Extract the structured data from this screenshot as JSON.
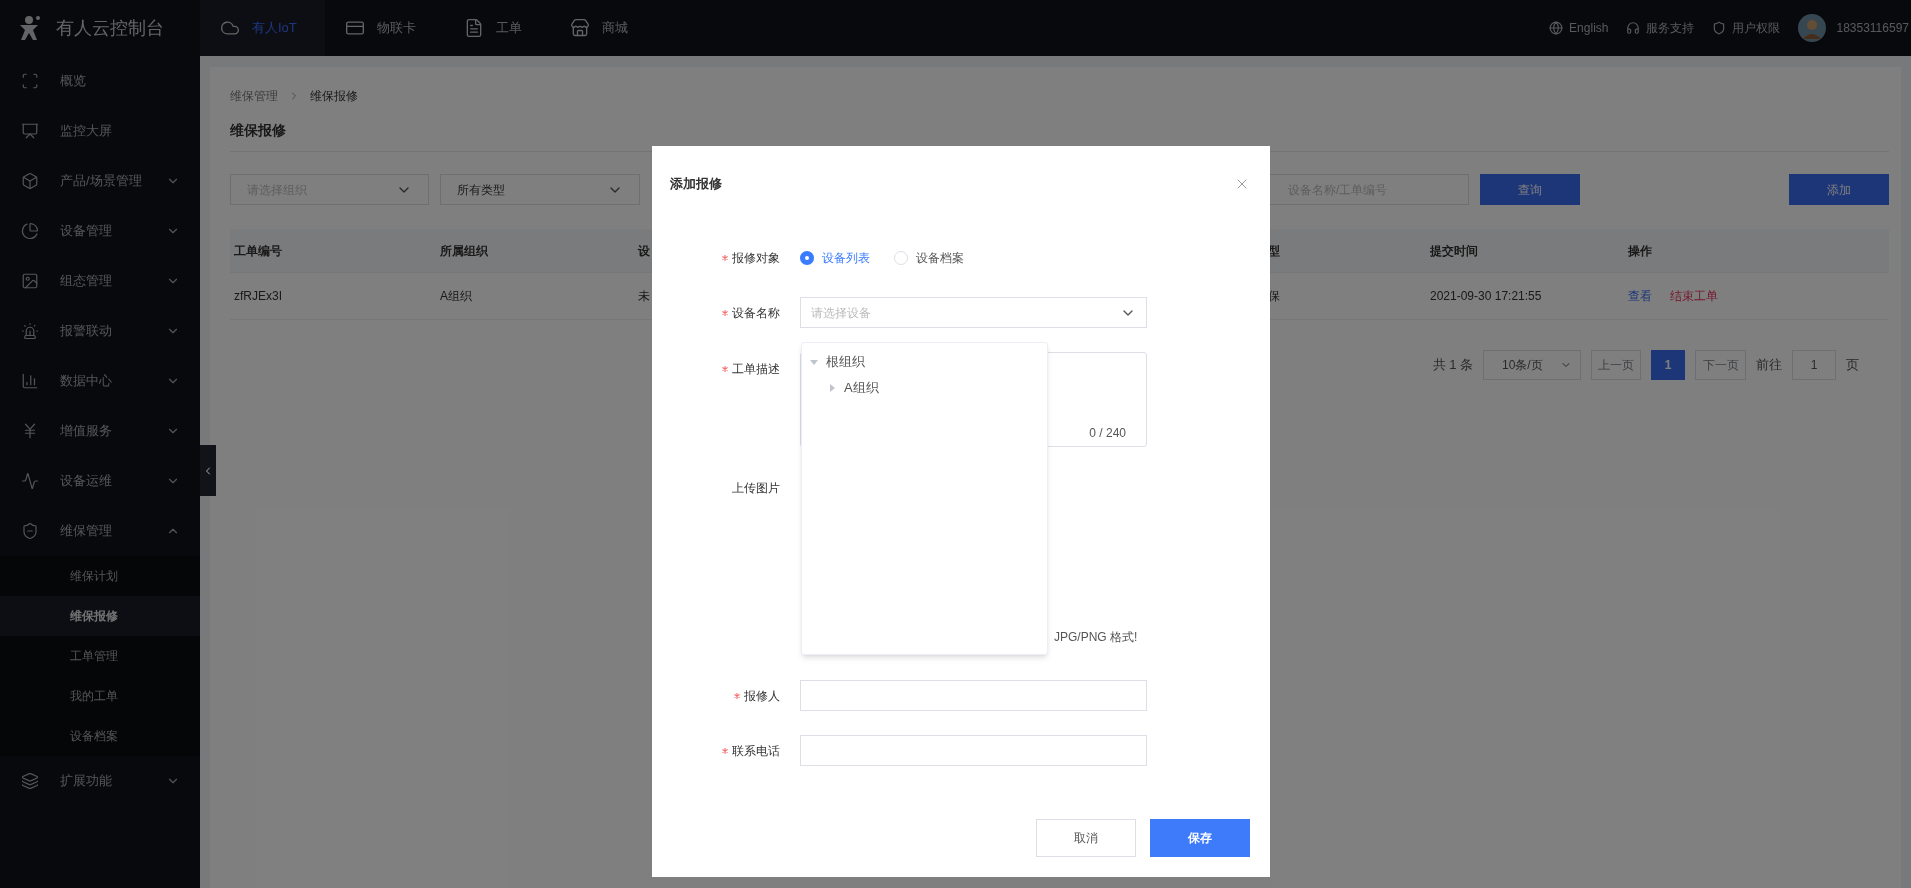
{
  "top_bar": {
    "logo": "有人云控制台",
    "tabs": [
      {
        "label": "有人IoT",
        "selected": true
      },
      {
        "label": "物联卡",
        "selected": false
      },
      {
        "label": "工单",
        "selected": false
      },
      {
        "label": "商城",
        "selected": false
      }
    ],
    "links": [
      "English",
      "服务支持",
      "用户权限"
    ],
    "user": "18353116597"
  },
  "sidebar": {
    "items": [
      {
        "label": "概览",
        "kind": "link"
      },
      {
        "label": "监控大屏",
        "kind": "link"
      },
      {
        "label": "产品/场景管理",
        "kind": "group",
        "expanded": false
      },
      {
        "label": "设备管理",
        "kind": "group",
        "expanded": false
      },
      {
        "label": "组态管理",
        "kind": "group",
        "expanded": false
      },
      {
        "label": "报警联动",
        "kind": "group",
        "expanded": false
      },
      {
        "label": "数据中心",
        "kind": "group",
        "expanded": false
      },
      {
        "label": "增值服务",
        "kind": "group",
        "expanded": false
      },
      {
        "label": "设备运维",
        "kind": "group",
        "expanded": false
      },
      {
        "label": "维保管理",
        "kind": "group",
        "expanded": true,
        "children": [
          {
            "label": "维保计划",
            "selected": false
          },
          {
            "label": "维保报修",
            "selected": true
          },
          {
            "label": "工单管理",
            "selected": false
          },
          {
            "label": "我的工单",
            "selected": false
          },
          {
            "label": "设备档案",
            "selected": false
          }
        ]
      },
      {
        "label": "扩展功能",
        "kind": "group",
        "expanded": false
      }
    ]
  },
  "breadcrumb": [
    "维保管理",
    "维保报修"
  ],
  "page_title": "维保报修",
  "filters": {
    "org_select": {
      "placeholder": "请选择组织"
    },
    "type_select": {
      "value": "所有类型"
    },
    "search": {
      "placeholder": "设备名称/工单编号"
    },
    "query_button": "查询",
    "add_button": "添加"
  },
  "table": {
    "columns": [
      "工单编号",
      "所属组织",
      "设",
      "型",
      "提交时间",
      "操作"
    ],
    "rows": [
      {
        "cells": [
          "zfRJEx3I",
          "A组织",
          "未",
          "保",
          "2021-09-30 17:21:55"
        ],
        "actions": [
          {
            "label": "查看",
            "kind": "view"
          },
          {
            "label": "结束工单",
            "kind": "danger"
          }
        ]
      }
    ]
  },
  "pagination": {
    "total": "共 1 条",
    "page_size": "10条/页",
    "prev": {
      "label": "上一页",
      "disabled": true
    },
    "pages": [
      {
        "label": "1",
        "selected": true
      }
    ],
    "next": {
      "label": "下一页",
      "disabled": true
    },
    "goto_label": "前往",
    "goto_value": "1",
    "page_suffix": "页"
  },
  "dialog": {
    "title": "添加报修",
    "fields": [
      {
        "kind": "radio",
        "label": "报修对象",
        "required": true,
        "options": [
          {
            "label": "设备列表",
            "selected": true
          },
          {
            "label": "设备档案",
            "selected": false
          }
        ]
      },
      {
        "kind": "select",
        "label": "设备名称",
        "required": true,
        "placeholder": "请选择设备"
      },
      {
        "kind": "textarea",
        "label": "工单描述",
        "required": true,
        "counter": "0 / 240"
      },
      {
        "kind": "upload",
        "label": "上传图片",
        "required": false,
        "hint": "JPG/PNG 格式!"
      },
      {
        "kind": "input",
        "label": "报修人",
        "required": true
      },
      {
        "kind": "input",
        "label": "联系电话",
        "required": true
      }
    ],
    "tree_dropdown": {
      "nodes": [
        {
          "label": "根组织",
          "expanded": true,
          "children": [
            {
              "label": "A组织",
              "expanded": false
            }
          ]
        }
      ]
    },
    "buttons": [
      {
        "label": "取消",
        "kind": "secondary"
      },
      {
        "label": "保存",
        "kind": "primary"
      }
    ]
  }
}
